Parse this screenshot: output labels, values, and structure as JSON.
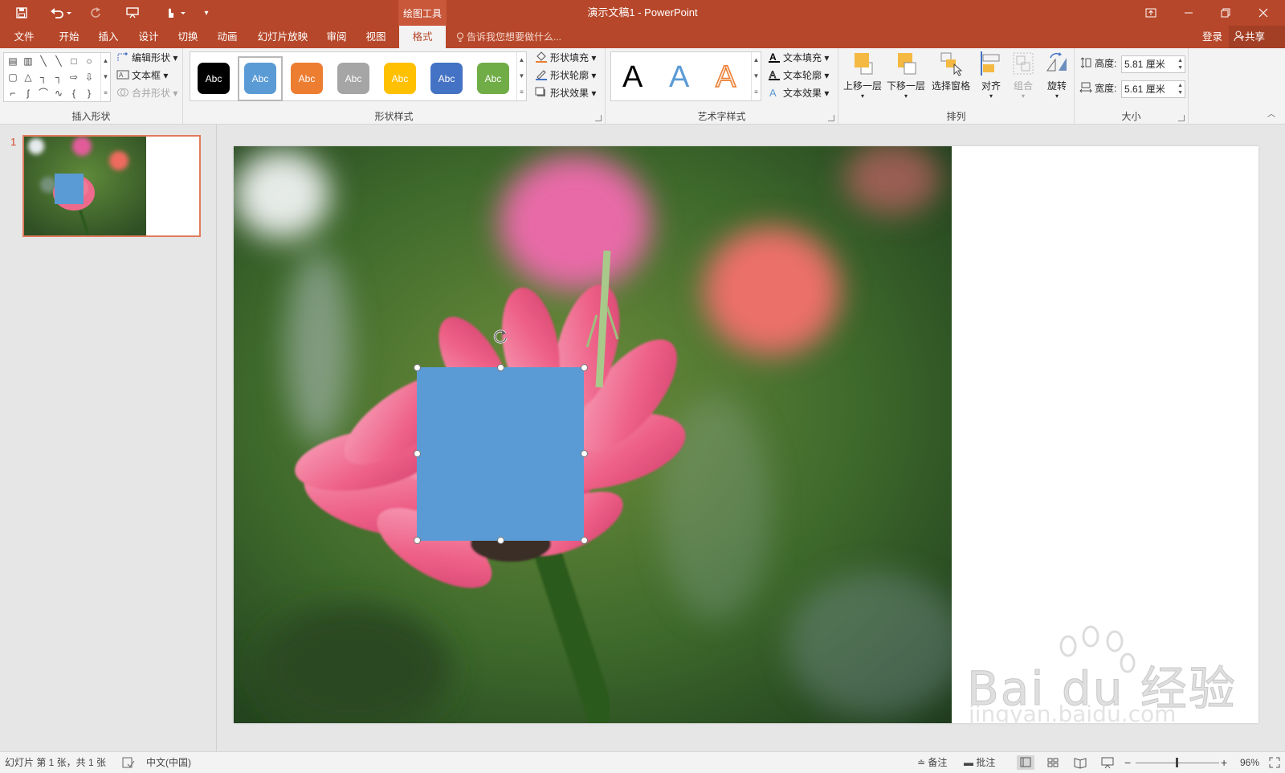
{
  "titlebar": {
    "title": "演示文稿1 - PowerPoint",
    "context_tools": "绘图工具",
    "icons": [
      "save-icon",
      "undo-icon",
      "redo-icon",
      "present-icon",
      "touch-mode-icon",
      "customize-qat-icon",
      "ribbon-display-icon",
      "minimize-icon",
      "restore-icon",
      "close-icon"
    ]
  },
  "tabs": {
    "items": [
      "文件",
      "开始",
      "插入",
      "设计",
      "切换",
      "动画",
      "幻灯片放映",
      "审阅",
      "视图",
      "格式"
    ],
    "active": "格式",
    "tell_me": "告诉我您想要做什么...",
    "login": "登录",
    "share": "共享"
  },
  "ribbon": {
    "insert_shapes": {
      "label": "插入形状",
      "edit_shape": "编辑形状",
      "text_box": "文本框",
      "merge_shapes": "合并形状"
    },
    "shape_styles": {
      "label": "形状样式",
      "swatch_text": "Abc",
      "swatches": [
        {
          "color": "#000000",
          "text": "Abc"
        },
        {
          "color": "#5b9bd5",
          "text": "Abc"
        },
        {
          "color": "#ed7d31",
          "text": "Abc"
        },
        {
          "color": "#a5a5a5",
          "text": "Abc"
        },
        {
          "color": "#ffc000",
          "text": "Abc"
        },
        {
          "color": "#4472c4",
          "text": "Abc"
        },
        {
          "color": "#70ad47",
          "text": "Abc"
        }
      ],
      "fill": "形状填充",
      "outline": "形状轮廓",
      "effects": "形状效果"
    },
    "wordart": {
      "label": "艺术字样式",
      "letter": "A",
      "text_fill": "文本填充",
      "text_outline": "文本轮廓",
      "text_effects": "文本效果"
    },
    "arrange": {
      "label": "排列",
      "bring_forward": "上移一层",
      "send_backward": "下移一层",
      "selection_pane": "选择窗格",
      "align": "对齐",
      "group": "组合",
      "rotate": "旋转"
    },
    "size": {
      "label": "大小",
      "height_label": "高度:",
      "height_value": "5.81 厘米",
      "width_label": "宽度:",
      "width_value": "5.61 厘米"
    }
  },
  "thumbnails": {
    "slide_number": "1"
  },
  "slide": {
    "shape_color": "#5b9bd5",
    "watermark_brand": "Bai du 经验",
    "watermark_url": "jingyan.baidu.com"
  },
  "statusbar": {
    "slide_info": "幻灯片 第 1 张，共 1 张",
    "language": "中文(中国)",
    "notes": "备注",
    "comments": "批注",
    "zoom": "96%"
  },
  "colors": {
    "accent": "#b7472a",
    "ribbon_bg": "#f3f3f3"
  }
}
